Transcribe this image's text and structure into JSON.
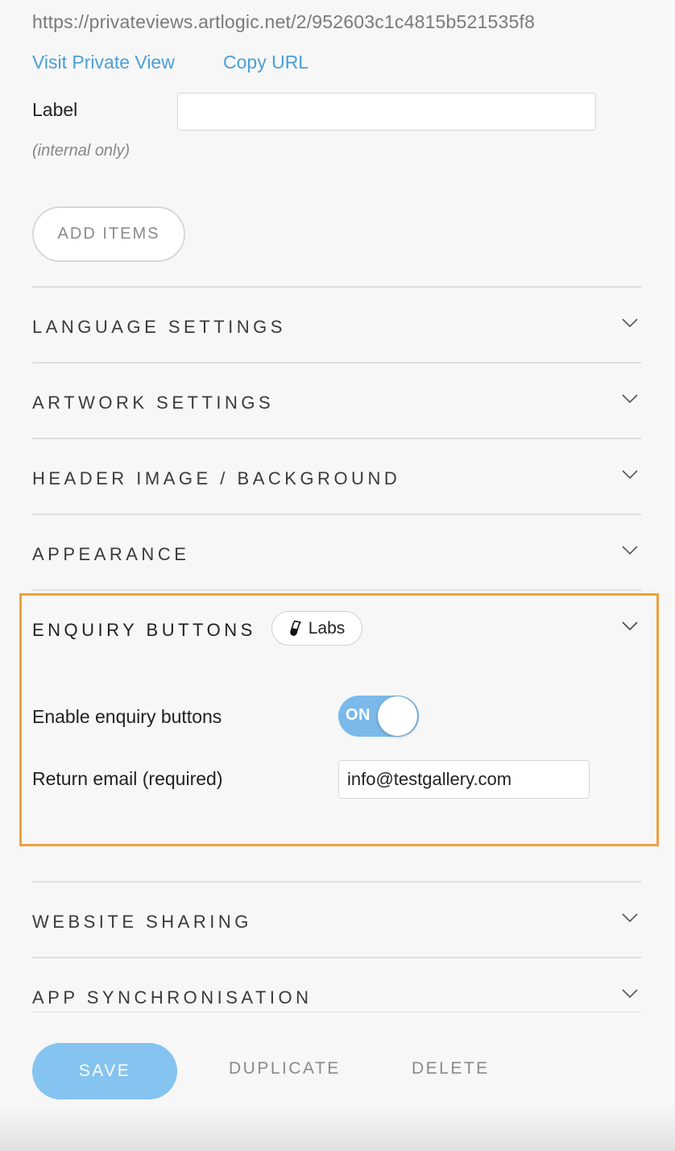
{
  "private_view": {
    "url": "https://privateviews.artlogic.net/2/952603c1c4815b521535f8",
    "visit_label": "Visit Private View",
    "copy_label": "Copy URL"
  },
  "label_field": {
    "label": "Label",
    "value": "",
    "placeholder": "",
    "note": "(internal only)"
  },
  "add_items_label": "ADD ITEMS",
  "sections": {
    "language": "LANGUAGE SETTINGS",
    "artwork": "ARTWORK SETTINGS",
    "header_image": "HEADER IMAGE / BACKGROUND",
    "appearance": "APPEARANCE",
    "enquiry": "ENQUIRY BUTTONS",
    "website_sharing": "WEBSITE SHARING",
    "app_sync": "APP SYNCHRONISATION"
  },
  "enquiry": {
    "badge_label": "Labs",
    "badge_icon": "flask-icon",
    "enable_label": "Enable enquiry buttons",
    "toggle_text": "ON",
    "toggle_state": true,
    "email_label": "Return email (required)",
    "email_value": "info@testgallery.com",
    "highlight_color": "#f0a03c"
  },
  "actions": {
    "save": "SAVE",
    "duplicate": "DUPLICATE",
    "delete": "DELETE"
  },
  "colors": {
    "link": "#4a9fd8",
    "save_button": "#85c3f1",
    "toggle_on": "#7ab9ea"
  }
}
